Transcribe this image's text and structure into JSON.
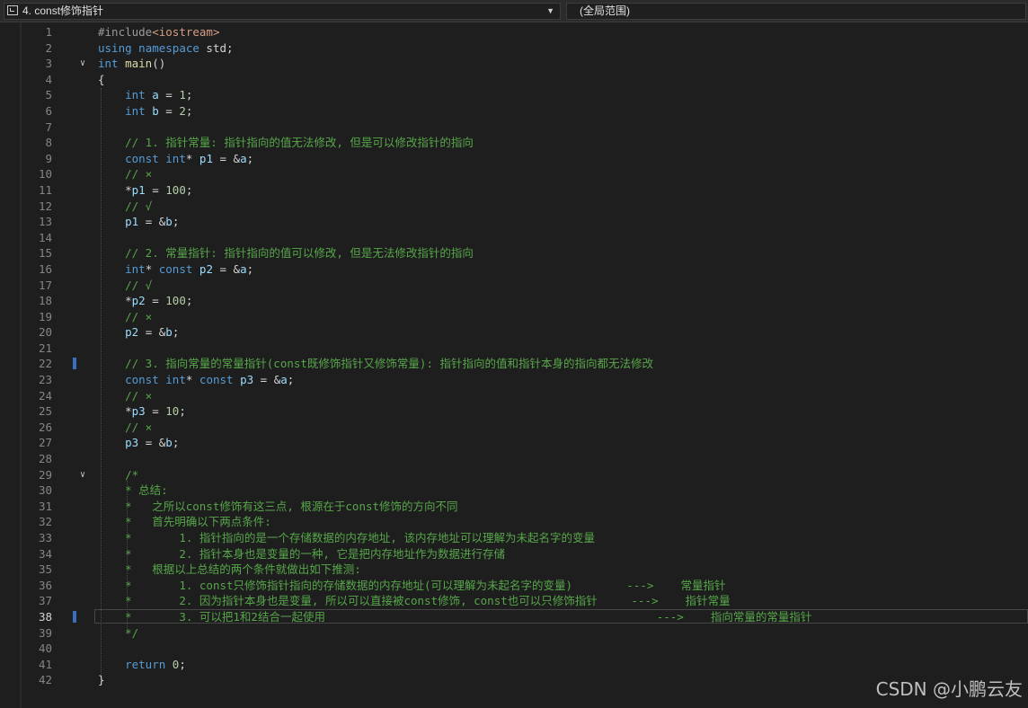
{
  "file_selector": {
    "label": "4. const修饰指针"
  },
  "scope_selector": {
    "label": "(全局范围)"
  },
  "lines": [
    {
      "n": "1",
      "tokens": [
        {
          "t": "#include",
          "c": "pre"
        },
        {
          "t": "<iostream>",
          "c": "str"
        }
      ]
    },
    {
      "n": "2",
      "tokens": [
        {
          "t": "using",
          "c": "kw"
        },
        {
          "t": " "
        },
        {
          "t": "namespace",
          "c": "kw"
        },
        {
          "t": " std;"
        }
      ]
    },
    {
      "n": "3",
      "tokens": [
        {
          "t": "int",
          "c": "kw"
        },
        {
          "t": " "
        },
        {
          "t": "main",
          "c": "fn"
        },
        {
          "t": "()"
        }
      ]
    },
    {
      "n": "4",
      "tokens": [
        {
          "t": "{"
        }
      ]
    },
    {
      "n": "5",
      "tokens": [
        {
          "t": "    "
        },
        {
          "t": "int",
          "c": "kw"
        },
        {
          "t": " "
        },
        {
          "t": "a",
          "c": "var"
        },
        {
          "t": " = "
        },
        {
          "t": "1",
          "c": "num"
        },
        {
          "t": ";"
        }
      ]
    },
    {
      "n": "6",
      "tokens": [
        {
          "t": "    "
        },
        {
          "t": "int",
          "c": "kw"
        },
        {
          "t": " "
        },
        {
          "t": "b",
          "c": "var"
        },
        {
          "t": " = "
        },
        {
          "t": "2",
          "c": "num"
        },
        {
          "t": ";"
        }
      ]
    },
    {
      "n": "7",
      "tokens": []
    },
    {
      "n": "8",
      "tokens": [
        {
          "t": "    "
        },
        {
          "t": "// 1. 指针常量: 指针指向的值无法修改, 但是可以修改指针的指向",
          "c": "cm"
        }
      ]
    },
    {
      "n": "9",
      "tokens": [
        {
          "t": "    "
        },
        {
          "t": "const",
          "c": "kw"
        },
        {
          "t": " "
        },
        {
          "t": "int",
          "c": "kw"
        },
        {
          "t": "* "
        },
        {
          "t": "p1",
          "c": "var"
        },
        {
          "t": " = &"
        },
        {
          "t": "a",
          "c": "var"
        },
        {
          "t": ";"
        }
      ]
    },
    {
      "n": "10",
      "tokens": [
        {
          "t": "    "
        },
        {
          "t": "// ×",
          "c": "cm"
        }
      ]
    },
    {
      "n": "11",
      "tokens": [
        {
          "t": "    *"
        },
        {
          "t": "p1",
          "c": "var"
        },
        {
          "t": " = "
        },
        {
          "t": "100",
          "c": "num"
        },
        {
          "t": ";"
        }
      ]
    },
    {
      "n": "12",
      "tokens": [
        {
          "t": "    "
        },
        {
          "t": "// √",
          "c": "cm"
        }
      ]
    },
    {
      "n": "13",
      "tokens": [
        {
          "t": "    "
        },
        {
          "t": "p1",
          "c": "var"
        },
        {
          "t": " = &"
        },
        {
          "t": "b",
          "c": "var"
        },
        {
          "t": ";"
        }
      ]
    },
    {
      "n": "14",
      "tokens": []
    },
    {
      "n": "15",
      "tokens": [
        {
          "t": "    "
        },
        {
          "t": "// 2. 常量指针: 指针指向的值可以修改, 但是无法修改指针的指向",
          "c": "cm"
        }
      ]
    },
    {
      "n": "16",
      "tokens": [
        {
          "t": "    "
        },
        {
          "t": "int",
          "c": "kw"
        },
        {
          "t": "* "
        },
        {
          "t": "const",
          "c": "kw"
        },
        {
          "t": " "
        },
        {
          "t": "p2",
          "c": "var"
        },
        {
          "t": " = &"
        },
        {
          "t": "a",
          "c": "var"
        },
        {
          "t": ";"
        }
      ]
    },
    {
      "n": "17",
      "tokens": [
        {
          "t": "    "
        },
        {
          "t": "// √",
          "c": "cm"
        }
      ]
    },
    {
      "n": "18",
      "tokens": [
        {
          "t": "    *"
        },
        {
          "t": "p2",
          "c": "var"
        },
        {
          "t": " = "
        },
        {
          "t": "100",
          "c": "num"
        },
        {
          "t": ";"
        }
      ]
    },
    {
      "n": "19",
      "tokens": [
        {
          "t": "    "
        },
        {
          "t": "// ×",
          "c": "cm"
        }
      ]
    },
    {
      "n": "20",
      "tokens": [
        {
          "t": "    "
        },
        {
          "t": "p2",
          "c": "var"
        },
        {
          "t": " = &"
        },
        {
          "t": "b",
          "c": "var"
        },
        {
          "t": ";"
        }
      ]
    },
    {
      "n": "21",
      "tokens": []
    },
    {
      "n": "22",
      "mark": true,
      "tokens": [
        {
          "t": "    "
        },
        {
          "t": "// 3. 指向常量的常量指针(const既修饰指针又修饰常量): 指针指向的值和指针本身的指向都无法修改",
          "c": "cm"
        }
      ]
    },
    {
      "n": "23",
      "tokens": [
        {
          "t": "    "
        },
        {
          "t": "const",
          "c": "kw"
        },
        {
          "t": " "
        },
        {
          "t": "int",
          "c": "kw"
        },
        {
          "t": "* "
        },
        {
          "t": "const",
          "c": "kw"
        },
        {
          "t": " "
        },
        {
          "t": "p3",
          "c": "var"
        },
        {
          "t": " = &"
        },
        {
          "t": "a",
          "c": "var"
        },
        {
          "t": ";"
        }
      ]
    },
    {
      "n": "24",
      "tokens": [
        {
          "t": "    "
        },
        {
          "t": "// ×",
          "c": "cm"
        }
      ]
    },
    {
      "n": "25",
      "tokens": [
        {
          "t": "    *"
        },
        {
          "t": "p3",
          "c": "var"
        },
        {
          "t": " = "
        },
        {
          "t": "10",
          "c": "num"
        },
        {
          "t": ";"
        }
      ]
    },
    {
      "n": "26",
      "tokens": [
        {
          "t": "    "
        },
        {
          "t": "// ×",
          "c": "cm"
        }
      ]
    },
    {
      "n": "27",
      "tokens": [
        {
          "t": "    "
        },
        {
          "t": "p3",
          "c": "var"
        },
        {
          "t": " = &"
        },
        {
          "t": "b",
          "c": "var"
        },
        {
          "t": ";"
        }
      ]
    },
    {
      "n": "28",
      "tokens": []
    },
    {
      "n": "29",
      "tokens": [
        {
          "t": "    "
        },
        {
          "t": "/*",
          "c": "cm"
        }
      ]
    },
    {
      "n": "30",
      "tokens": [
        {
          "t": "    "
        },
        {
          "t": "* 总结:",
          "c": "cm"
        }
      ]
    },
    {
      "n": "31",
      "tokens": [
        {
          "t": "    "
        },
        {
          "t": "*   之所以const修饰有这三点, 根源在于const修饰的方向不同",
          "c": "cm"
        }
      ]
    },
    {
      "n": "32",
      "tokens": [
        {
          "t": "    "
        },
        {
          "t": "*   首先明确以下两点条件:",
          "c": "cm"
        }
      ]
    },
    {
      "n": "33",
      "tokens": [
        {
          "t": "    "
        },
        {
          "t": "*       1. 指针指向的是一个存储数据的内存地址, 该内存地址可以理解为未起名字的变量",
          "c": "cm"
        }
      ]
    },
    {
      "n": "34",
      "tokens": [
        {
          "t": "    "
        },
        {
          "t": "*       2. 指针本身也是变量的一种, 它是把内存地址作为数据进行存储",
          "c": "cm"
        }
      ]
    },
    {
      "n": "35",
      "tokens": [
        {
          "t": "    "
        },
        {
          "t": "*   根据以上总结的两个条件就做出如下推测:",
          "c": "cm"
        }
      ]
    },
    {
      "n": "36",
      "tokens": [
        {
          "t": "    "
        },
        {
          "t": "*       1. const只修饰指针指向的存储数据的内存地址(可以理解为未起名字的变量)        --->    常量指针",
          "c": "cm"
        }
      ]
    },
    {
      "n": "37",
      "tokens": [
        {
          "t": "    "
        },
        {
          "t": "*       2. 因为指针本身也是变量, 所以可以直接被const修饰, const也可以只修饰指针     --->    指针常量",
          "c": "cm"
        }
      ]
    },
    {
      "n": "38",
      "cur": true,
      "mark": true,
      "tokens": [
        {
          "t": "    "
        },
        {
          "t": "*       3. 可以把1和2结合一起使用                                                 --->    指向常量的常量指针",
          "c": "cm"
        }
      ]
    },
    {
      "n": "39",
      "tokens": [
        {
          "t": "    "
        },
        {
          "t": "*/",
          "c": "cm"
        }
      ]
    },
    {
      "n": "40",
      "tokens": []
    },
    {
      "n": "41",
      "tokens": [
        {
          "t": "    "
        },
        {
          "t": "return",
          "c": "kw"
        },
        {
          "t": " "
        },
        {
          "t": "0",
          "c": "num"
        },
        {
          "t": ";"
        }
      ]
    },
    {
      "n": "42",
      "tokens": [
        {
          "t": "}"
        }
      ]
    }
  ],
  "fold_lines": [
    "3",
    "29"
  ],
  "watermark": "CSDN @小鹏云友",
  "colors": {
    "background": "#1e1e1e",
    "keyword": "#569cd6",
    "comment": "#57a64a",
    "variable": "#9cdcfe",
    "number": "#b5cea8",
    "function": "#dcdcaa",
    "string": "#d69d85",
    "preprocessor": "#9b9b9b",
    "line_number": "#858585"
  }
}
